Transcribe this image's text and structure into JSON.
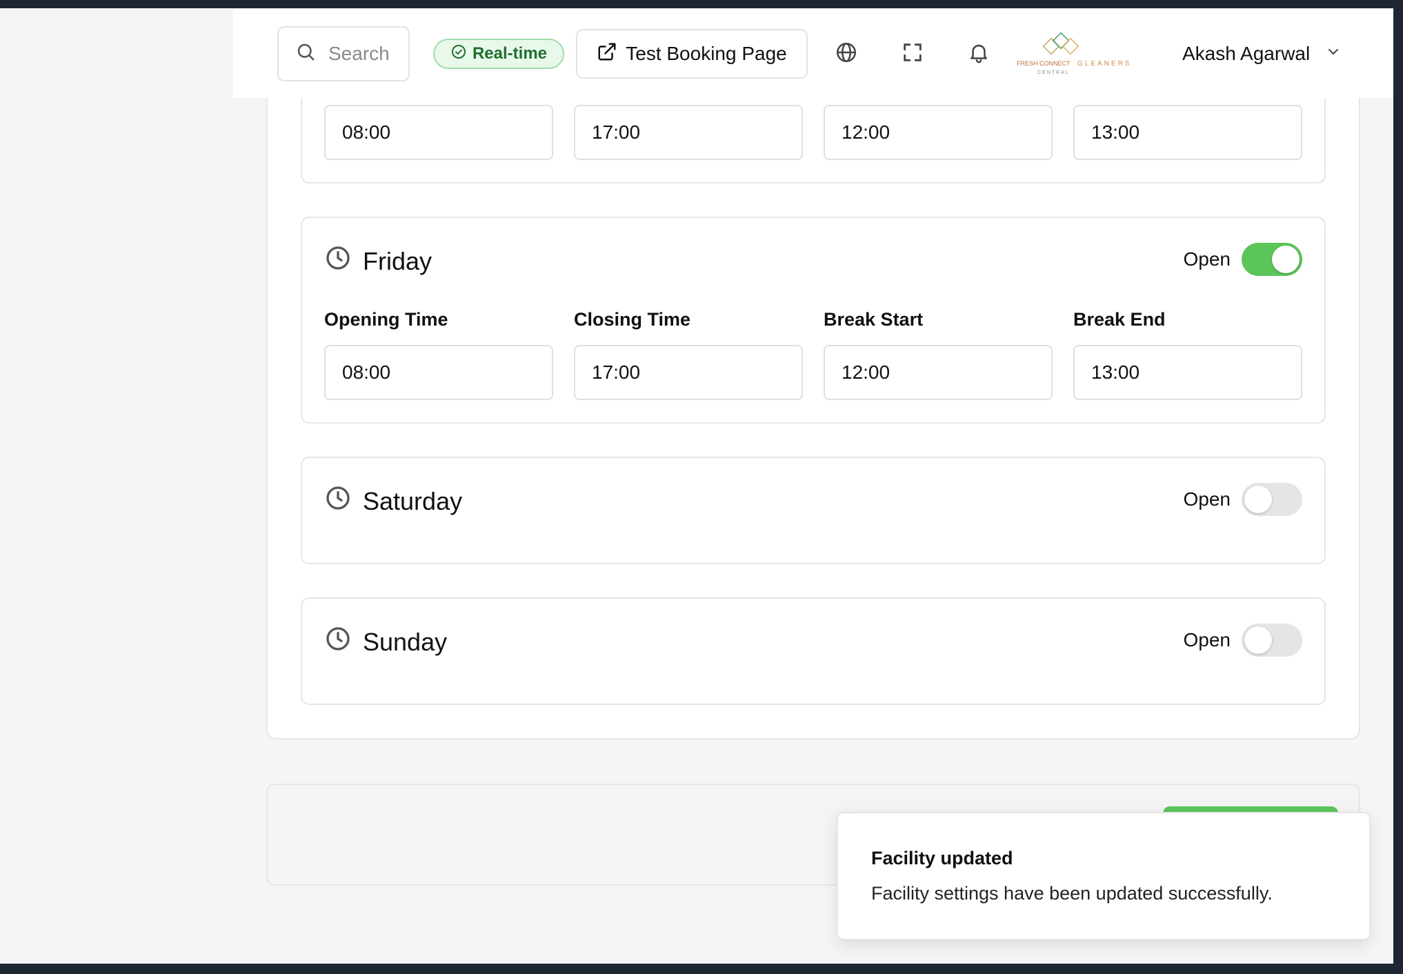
{
  "header": {
    "search_placeholder": "Search",
    "realtime_label": "Real-time",
    "test_booking_label": "Test Booking Page",
    "logo_text_left": "FRESH CONNECT",
    "logo_text_sub": "CENTRAL",
    "logo_text_right": "GLEANERS",
    "user_name": "Akash Agarwal"
  },
  "previous_day": {
    "opening": "08:00",
    "closing": "17:00",
    "break_start": "12:00",
    "break_end": "13:00"
  },
  "field_labels": {
    "opening": "Opening Time",
    "closing": "Closing Time",
    "break_start": "Break Start",
    "break_end": "Break End"
  },
  "days": {
    "friday": {
      "name": "Friday",
      "open_label": "Open",
      "is_open": true,
      "opening": "08:00",
      "closing": "17:00",
      "break_start": "12:00",
      "break_end": "13:00"
    },
    "saturday": {
      "name": "Saturday",
      "open_label": "Open",
      "is_open": false
    },
    "sunday": {
      "name": "Sunday",
      "open_label": "Open",
      "is_open": false
    }
  },
  "toast": {
    "title": "Facility updated",
    "message": "Facility settings have been updated successfully."
  },
  "colors": {
    "accent_green": "#5cc55a",
    "badge_green": "#1f6f2e"
  }
}
